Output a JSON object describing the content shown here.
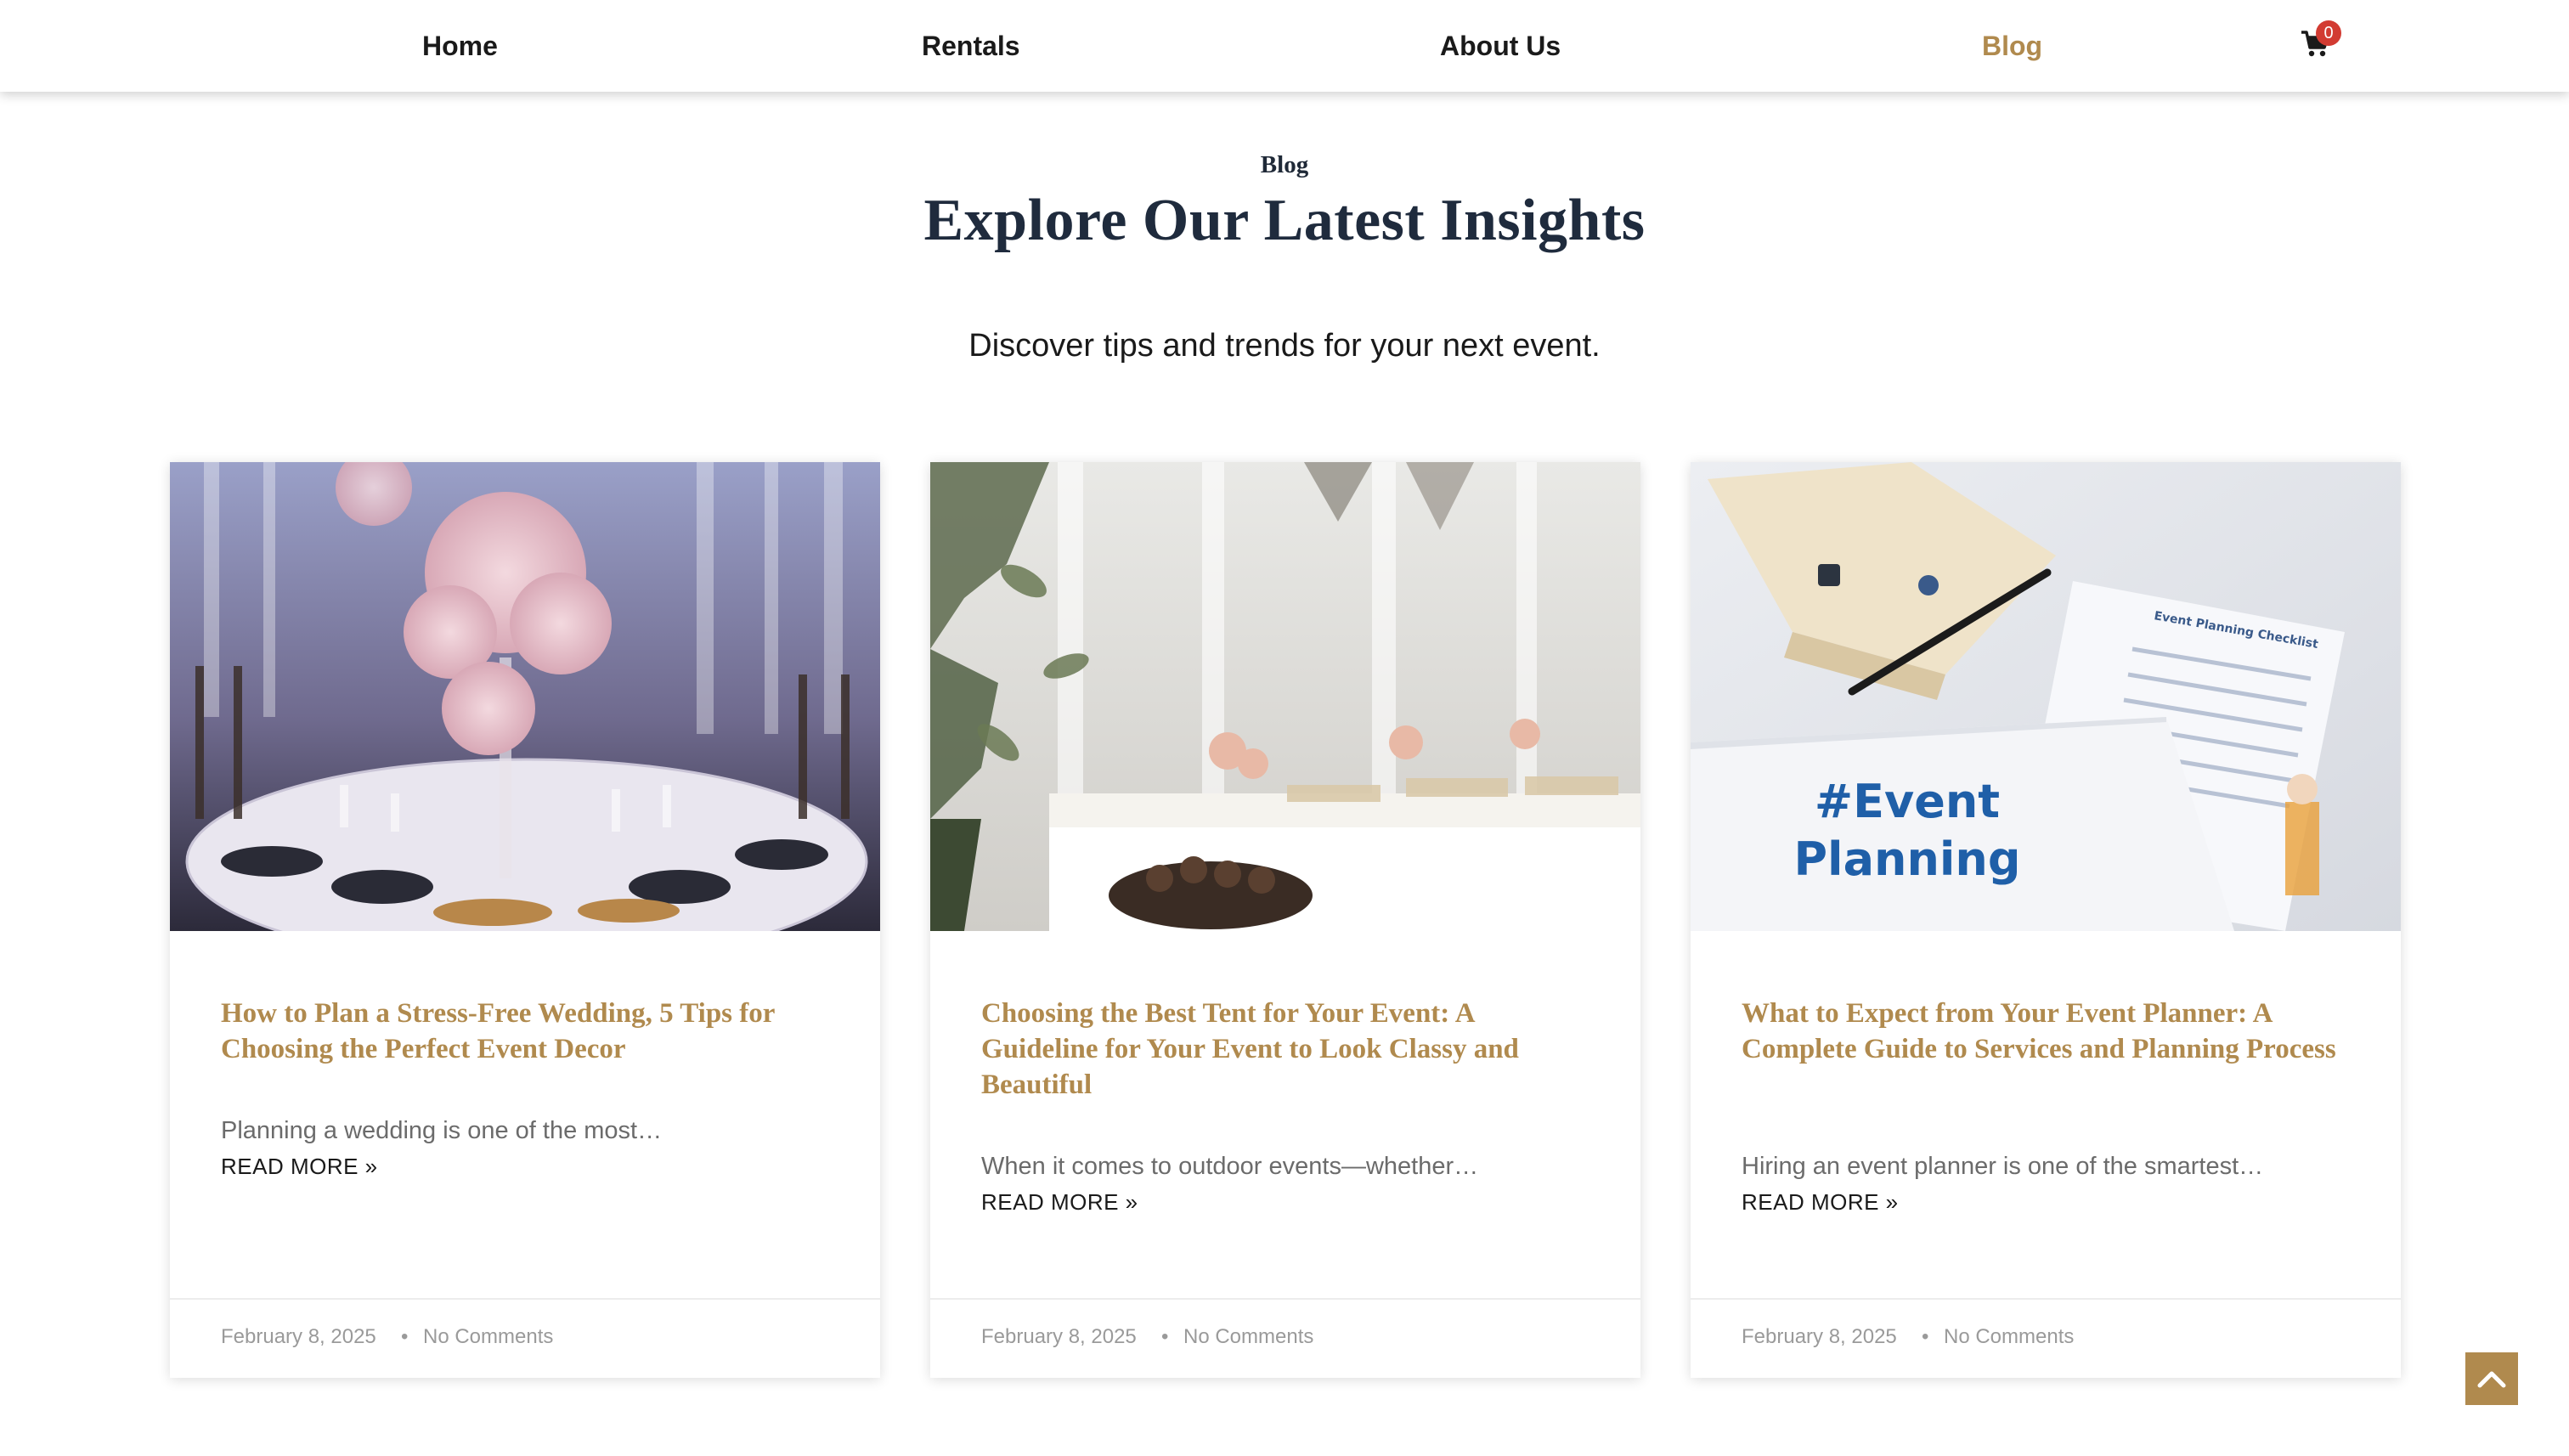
{
  "nav": {
    "items": [
      {
        "label": "Home",
        "active": false
      },
      {
        "label": "Rentals",
        "active": false
      },
      {
        "label": "About Us",
        "active": false
      },
      {
        "label": "Blog",
        "active": true
      }
    ],
    "cart_icon": "cart-icon",
    "cart_count": "0"
  },
  "hero": {
    "eyebrow": "Blog",
    "title": "Explore Our Latest Insights",
    "subtitle": "Discover tips and trends for your next event."
  },
  "posts": [
    {
      "title": "How to Plan a Stress-Free Wedding, 5 Tips for Choosing the Perfect Event Decor",
      "excerpt": "Planning a wedding is one of the most…",
      "read_more": "READ MORE »",
      "date": "February 8, 2025",
      "separator": "•",
      "comments": "No Comments"
    },
    {
      "title": "Choosing the Best Tent for Your Event: A Guideline for Your Event to Look Classy and Beautiful",
      "excerpt": "When it comes to outdoor events—whether…",
      "read_more": "READ MORE »",
      "date": "February 8, 2025",
      "separator": "•",
      "comments": "No Comments"
    },
    {
      "title": "What to Expect from Your Event Planner: A Complete Guide to Services and Planning Process",
      "excerpt": "Hiring an event planner is one of the smartest…",
      "read_more": "READ MORE »",
      "date": "February 8, 2025",
      "separator": "•",
      "comments": "No Comments"
    }
  ],
  "image_text": {
    "hashtag_line1": "#Event",
    "hashtag_line2": "Planning",
    "checklist_title": "Event Planning Checklist"
  },
  "scroll_top_icon": "chevron-up-icon",
  "colors": {
    "accent": "#b08a4e",
    "badge": "#d23b32",
    "heading": "#1f2b3d"
  }
}
